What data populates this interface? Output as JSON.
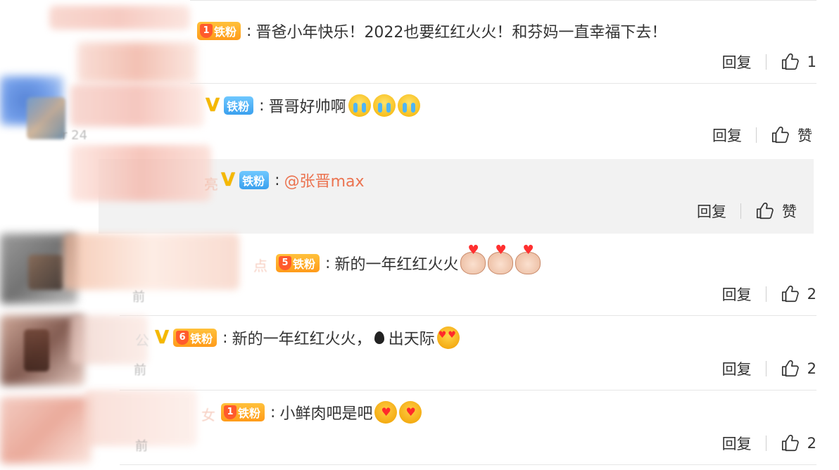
{
  "reply_label": "回复",
  "comments": [
    {
      "badge": "铁粉",
      "badge_level": "1",
      "text": "晋爸小年快乐！2022也要红红火火！和芬妈一直幸福下去！",
      "likes": "1"
    },
    {
      "vip": "V",
      "badge": "铁粉",
      "text": "晋哥好帅啊",
      "emojis": [
        "cry",
        "cry",
        "cry"
      ],
      "likes": "赞"
    },
    {
      "name_fragment": "亮",
      "vip": "V",
      "badge": "铁粉",
      "mention": "@张晋max",
      "likes": "赞"
    },
    {
      "name_fragment": "点",
      "badge": "铁粉",
      "badge_level": "5",
      "text": "新的一年红红火火",
      "emojis": [
        "pig",
        "pig",
        "pig"
      ],
      "meta_fragment": "前",
      "likes": "2"
    },
    {
      "name_fragment": "公",
      "vip": "V",
      "badge": "铁粉",
      "badge_level": "6",
      "text_before": "新的一年红红火火，",
      "text_after": "出天际",
      "emojis": [
        "heart-eyes"
      ],
      "meta_fragment": "前",
      "likes": "2"
    },
    {
      "name_fragment": "女",
      "badge": "铁粉",
      "badge_level": "1",
      "text": "小鲜肉吧是吧",
      "emojis": [
        "kiss",
        "kiss"
      ],
      "meta_fragment": "前",
      "likes": "2"
    }
  ]
}
